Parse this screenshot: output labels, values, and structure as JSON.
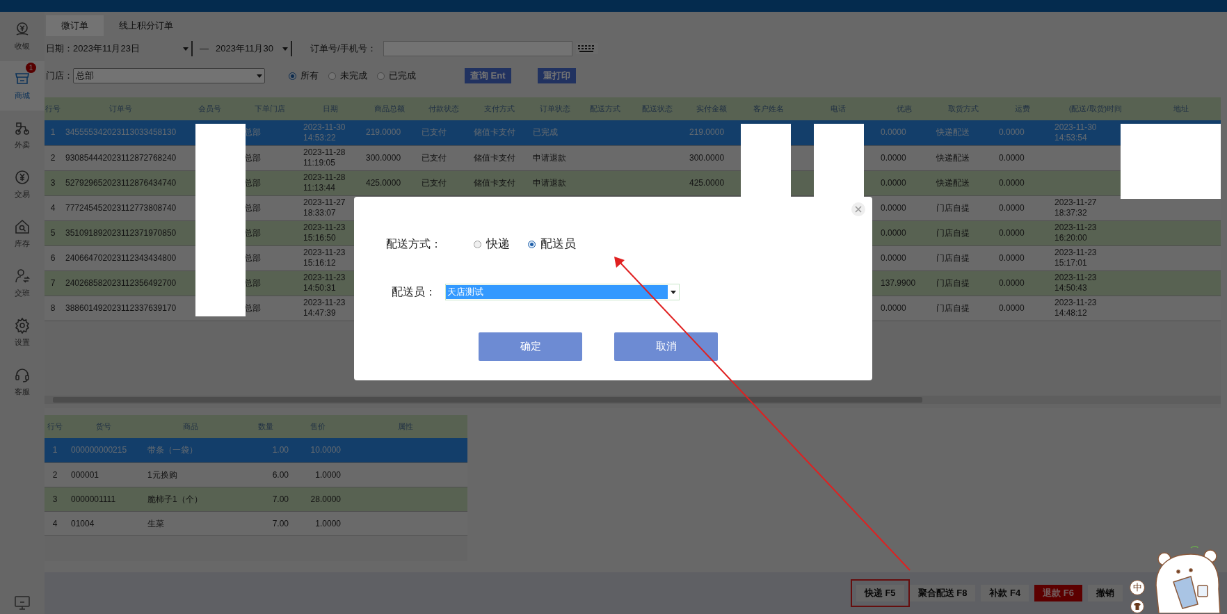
{
  "sidebar": {
    "items": [
      {
        "label": "收银",
        "selected": false
      },
      {
        "label": "商城",
        "selected": true,
        "badge": "1"
      },
      {
        "label": "外卖",
        "selected": false
      },
      {
        "label": "交易",
        "selected": false
      },
      {
        "label": "库存",
        "selected": false
      },
      {
        "label": "交班",
        "selected": false
      },
      {
        "label": "设置",
        "selected": false
      },
      {
        "label": "客服",
        "selected": false
      }
    ]
  },
  "tabs": [
    {
      "label": "微订单",
      "selected": true
    },
    {
      "label": "线上积分订单",
      "selected": false
    }
  ],
  "filters": {
    "date_label": "日期：",
    "date_from": "2023年11月23日",
    "date_sep": "—",
    "date_to": "2023年11月30",
    "order_label": "订单号/手机号：",
    "store_label": "门店：",
    "store_value": "总部",
    "status_options": [
      {
        "label": "所有",
        "selected": true
      },
      {
        "label": "未完成",
        "selected": false
      },
      {
        "label": "已完成",
        "selected": false
      }
    ],
    "buttons": [
      "查询 Ent",
      "重打印"
    ]
  },
  "orders": {
    "columns": [
      "行号",
      "订单号",
      "会员号",
      "下单门店",
      "日期",
      "商品总额",
      "付款状态",
      "支付方式",
      "订单状态",
      "配送方式",
      "配送状态",
      "实付金额",
      "客户姓名",
      "电话",
      "优惠",
      "取货方式",
      "运费",
      "(配送/取货)时间",
      "地址"
    ],
    "rows": [
      {
        "selected": true,
        "no": "1",
        "order_no": "345555342023113033458130",
        "store": "总部",
        "date": "2023-11-30 14:53:22",
        "goods_total": "219.0000",
        "pay_status": "已支付",
        "pay_method": "储值卡支付",
        "order_status": "已完成",
        "paid": "219.0000",
        "discount": "0.0000",
        "pickup": "快递配送",
        "freight": "0.0000",
        "time": "2023-11-30 14:53:54"
      },
      {
        "selected": false,
        "no": "2",
        "order_no": "930854442023112872768240",
        "store": "总部",
        "date": "2023-11-28 11:19:05",
        "goods_total": "300.0000",
        "pay_status": "已支付",
        "pay_method": "储值卡支付",
        "order_status": "申请退款",
        "paid": "300.0000",
        "discount": "0.0000",
        "pickup": "快递配送",
        "freight": "0.0000"
      },
      {
        "selected": false,
        "no": "3",
        "order_no": "527929652023112876434740",
        "store": "总部",
        "date": "2023-11-28 11:13:44",
        "goods_total": "425.0000",
        "pay_status": "已支付",
        "pay_method": "储值卡支付",
        "order_status": "申请退款",
        "paid": "425.0000",
        "discount": "0.0000",
        "pickup": "快递配送",
        "freight": "0.0000"
      },
      {
        "selected": false,
        "no": "4",
        "order_no": "777245452023112773808740",
        "store": "总部",
        "date": "2023-11-27 18:33:07",
        "discount": "0.0000",
        "pickup": "门店自提",
        "freight": "0.0000",
        "time": "2023-11-27 18:37:32"
      },
      {
        "selected": false,
        "no": "5",
        "order_no": "351091892023112371970850",
        "store": "总部",
        "date": "2023-11-23 15:16:50",
        "discount": "0.0000",
        "pickup": "门店自提",
        "freight": "0.0000",
        "time": "2023-11-23 16:20:00"
      },
      {
        "selected": false,
        "no": "6",
        "order_no": "240664702023112343434800",
        "store": "总部",
        "date": "2023-11-23 15:16:12",
        "discount": "0.0000",
        "pickup": "门店自提",
        "freight": "0.0000",
        "time": "2023-11-23 15:17:01"
      },
      {
        "selected": false,
        "no": "7",
        "order_no": "240268582023112356492700",
        "store": "总部",
        "date": "2023-11-23 14:50:31",
        "discount": "137.9900",
        "pickup": "门店自提",
        "freight": "0.0000",
        "time": "2023-11-23 14:50:43"
      },
      {
        "selected": false,
        "no": "8",
        "order_no": "388601492023112337639170",
        "store": "总部",
        "date": "2023-11-23 14:47:39",
        "discount": "0.0000",
        "pickup": "门店自提",
        "freight": "0.0000",
        "time": "2023-11-23 14:48:12"
      }
    ]
  },
  "items": {
    "columns": [
      "行号",
      "货号",
      "商品",
      "数量",
      "售价",
      "属性"
    ],
    "rows": [
      {
        "selected": true,
        "cells": [
          "1",
          "000000000215",
          "带条（一袋）",
          "1.00",
          "10.0000"
        ]
      },
      {
        "selected": false,
        "cells": [
          "2",
          "000001",
          "1元换购",
          "6.00",
          "1.0000"
        ]
      },
      {
        "selected": false,
        "cells": [
          "3",
          "0000001111",
          "脆柿子1（个）",
          "7.00",
          "28.0000"
        ]
      },
      {
        "selected": false,
        "cells": [
          "4",
          "01004",
          "生菜",
          "7.00",
          "1.0000"
        ]
      }
    ]
  },
  "actions": [
    {
      "label": "快递 F5",
      "kind": "normal",
      "annotated": true
    },
    {
      "label": "聚合配送 F8",
      "kind": "normal",
      "annotated": false
    },
    {
      "label": "补款 F4",
      "kind": "normal",
      "annotated": false
    },
    {
      "label": "退款 F6",
      "kind": "danger",
      "annotated": false
    },
    {
      "label": "撤销",
      "kind": "normal",
      "annotated": false
    }
  ],
  "dialog": {
    "method_label": "配送方式：",
    "methods": [
      {
        "label": "快递",
        "selected": false
      },
      {
        "label": "配送员",
        "selected": true
      }
    ],
    "courier_label": "配送员：",
    "courier_value": "天店测试",
    "buttons": [
      "确定",
      "取消"
    ]
  },
  "ime": {
    "label": "中"
  }
}
